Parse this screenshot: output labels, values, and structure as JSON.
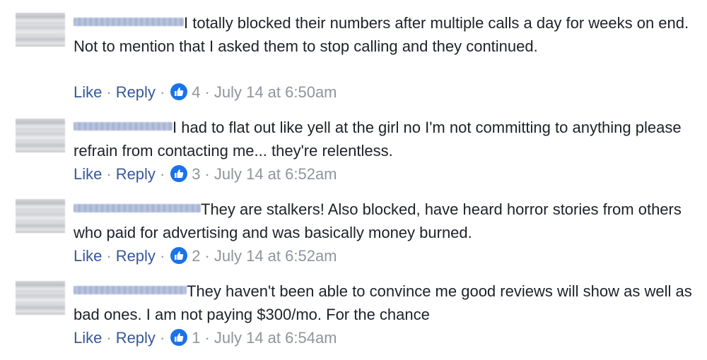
{
  "comments": [
    {
      "text": "I totally blocked their numbers after multiple calls a day for weeks on end. Not to mention that I asked them to stop calling and they continued.",
      "like_label": "Like",
      "reply_label": "Reply",
      "reactions": "4",
      "timestamp": "July 14 at 6:50am"
    },
    {
      "text": "I had to flat out like yell at the girl no I'm not committing to anything please refrain from contacting me... they're relentless.",
      "like_label": "Like",
      "reply_label": "Reply",
      "reactions": "3",
      "timestamp": "July 14 at 6:52am"
    },
    {
      "text": "They are stalkers! Also blocked, have heard horror stories from others who paid for advertising and was basically money burned.",
      "like_label": "Like",
      "reply_label": "Reply",
      "reactions": "2",
      "timestamp": "July 14 at 6:52am"
    },
    {
      "text": "They haven't been able to convince me good reviews will show as well as bad ones. I am not paying $300/mo. For the chance",
      "like_label": "Like",
      "reply_label": "Reply",
      "reactions": "1",
      "timestamp": "July 14 at 6:54am"
    }
  ],
  "separator": "·",
  "colors": {
    "link": "#365899",
    "meta": "#90949c",
    "text": "#1d2129",
    "like_badge": "#1a73e8"
  },
  "icons": {
    "reaction": "thumbs-up-icon"
  }
}
